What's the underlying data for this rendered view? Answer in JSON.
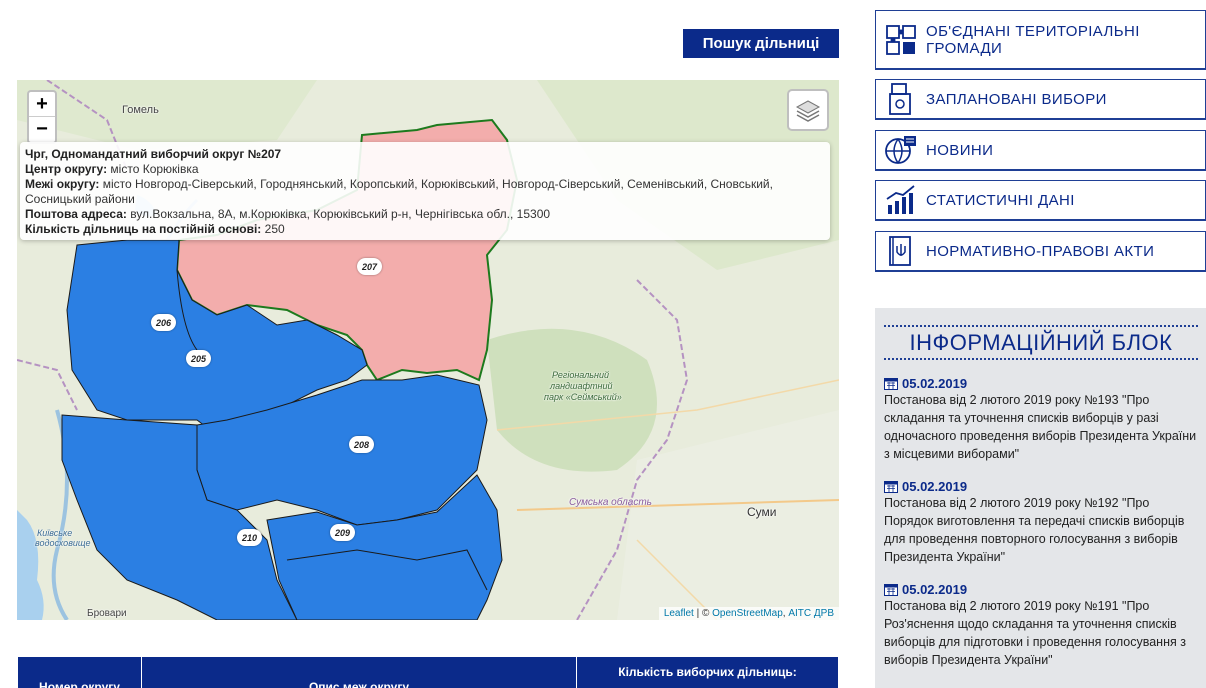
{
  "search_button": "Пошук дільниці",
  "map": {
    "zoom_in": "+",
    "zoom_out": "−",
    "popup": {
      "title": "Чрг, Одномандатний виборчий округ №207",
      "center_label": "Центр округу:",
      "center_value": "місто Корюківка",
      "borders_label": "Межі округу:",
      "borders_value": "місто Новгород-Сіверський, Городнянський, Коропський, Корюківський, Новгород-Сіверський, Семенівський, Сновський, Сосницький райони",
      "address_label": "Поштова адреса:",
      "address_value": "вул.Вокзальна, 8А, м.Корюківка, Корюківський р-н, Чернігівська обл., 15300",
      "count_label": "Кількість дільниць на постійній основі:",
      "count_value": "250"
    },
    "districts": [
      "207",
      "206",
      "205",
      "208",
      "210",
      "209"
    ],
    "places": {
      "gomel": "Гомель",
      "park1": "Регіональний",
      "park2": "ландшафтний",
      "park3": "парк «Сеймський»",
      "sumy_oblast": "Сумська область",
      "sumy": "Суми",
      "brovary": "Бровари",
      "kyiv_res1": "Київське",
      "kyiv_res2": "водосховище"
    },
    "attribution": {
      "leaflet": "Leaflet",
      "sep": " | © ",
      "osm": "OpenStreetMap",
      "comma": ", ",
      "aits": "АІТС ДРВ"
    }
  },
  "table": {
    "col1": "Номер округу",
    "col2": "Опис меж округу",
    "col3": "Кількість виборчих дільниць:"
  },
  "menu": [
    {
      "label": "ОБ'ЄДНАНІ ТЕРИТОРІАЛЬНІ ГРОМАДИ",
      "icon": "puzzle-icon"
    },
    {
      "label": "ЗАПЛАНОВАНІ ВИБОРИ",
      "icon": "ballot-box-icon"
    },
    {
      "label": "НОВИНИ",
      "icon": "globe-news-icon"
    },
    {
      "label": "СТАТИСТИЧНІ ДАНІ",
      "icon": "statistics-icon"
    },
    {
      "label": "НОРМАТИВНО-ПРАВОВІ АКТИ",
      "icon": "law-book-icon"
    }
  ],
  "info_block": {
    "title": "ІНФОРМАЦІЙНИЙ БЛОК",
    "news": [
      {
        "date": "05.02.2019",
        "text": "Постанова від 2 лютого 2019 року №193 \"Про складання та уточнення списків виборців у разі одночасного проведення виборів Президента України з місцевими виборами\""
      },
      {
        "date": "05.02.2019",
        "text": "Постанова від 2 лютого 2019 року №192 \"Про Порядок виготовлення та передачі списків виборців для проведення повторного голосування з виборів Президента України\""
      },
      {
        "date": "05.02.2019",
        "text": "Постанова від 2 лютого 2019 року №191 \"Про Роз'яснення щодо складання та уточнення списків виборців для підготовки і проведення голосування з виборів Президента України\""
      }
    ]
  },
  "colors": {
    "brand_blue": "#0b2a8a",
    "district_blue": "#2b7fe3",
    "district_selected": "#f4a6a6",
    "district_border_green": "#1d7a1d"
  }
}
